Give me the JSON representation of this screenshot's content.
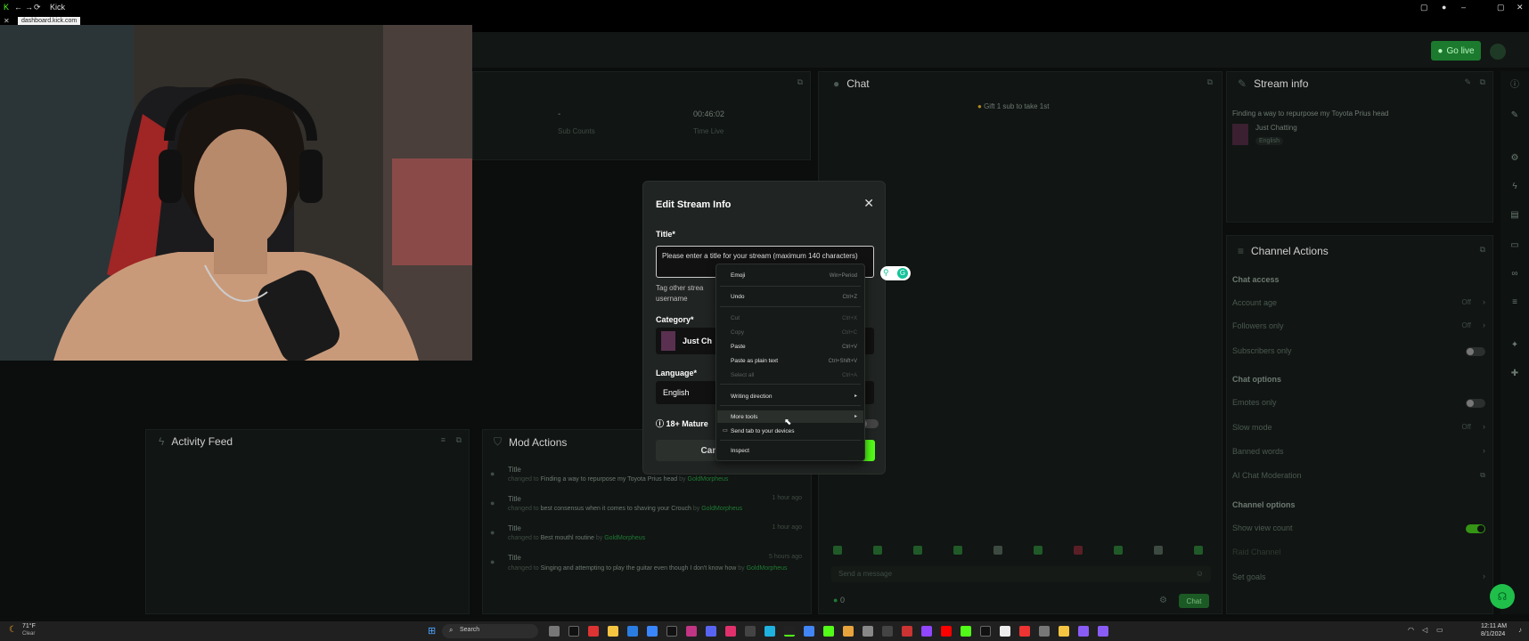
{
  "window": {
    "title": "Kick",
    "url": "dashboard.kick.com"
  },
  "header": {
    "go_live": "Go live"
  },
  "stats": {
    "sub_value": "-",
    "sub_label": "Sub Counts",
    "time_value": "00:46:02",
    "time_label": "Time Live"
  },
  "chat": {
    "title": "Chat",
    "gift_banner": "Gift 1 sub to take 1st",
    "input_placeholder": "Send a message",
    "viewer_count": "0",
    "send_label": "Chat"
  },
  "stream_info": {
    "title": "Stream info",
    "stream_title": "Finding a way to repurpose my Toyota Prius head",
    "category": "Just Chatting",
    "language": "English"
  },
  "channel_actions": {
    "title": "Channel Actions",
    "chat_access": "Chat access",
    "account_age": {
      "label": "Account age",
      "value": "Off"
    },
    "followers_only": {
      "label": "Followers only",
      "value": "Off"
    },
    "subscribers_only": {
      "label": "Subscribers only"
    },
    "chat_options": "Chat options",
    "emotes_only": {
      "label": "Emotes only"
    },
    "slow_mode": {
      "label": "Slow mode",
      "value": "Off"
    },
    "banned_words": "Banned words",
    "ai_moderation": "AI Chat Moderation",
    "channel_options": "Channel options",
    "show_view_count": "Show view count",
    "raid_channel": "Raid Channel",
    "set_goals": "Set goals"
  },
  "activity_feed": {
    "title": "Activity Feed"
  },
  "mod_actions": {
    "title": "Mod Actions",
    "entries": [
      {
        "title": "Title",
        "changed": "changed to",
        "text": "Finding a way to repurpose my Toyota Prius head",
        "by": "by",
        "user": "GoldMorpheus",
        "time": ""
      },
      {
        "title": "Title",
        "changed": "changed to",
        "text": "best consensus when it comes to shaving your Crouch",
        "by": "by",
        "user": "GoldMorpheus",
        "time": "1 hour ago"
      },
      {
        "title": "Title",
        "changed": "changed to",
        "text": "Best mouthl routine",
        "by": "by",
        "user": "GoldMorpheus",
        "time": "1 hour ago"
      },
      {
        "title": "Title",
        "changed": "changed to",
        "text": "Singing and attempting to play the guitar even though I don't know how",
        "by": "by",
        "user": "GoldMorpheus",
        "time": "5 hours ago"
      }
    ]
  },
  "modal": {
    "title": "Edit Stream Info",
    "title_label": "Title*",
    "title_placeholder": "Please enter a title for your stream (maximum 140 characters)",
    "tag_hint_1": "Tag other strea",
    "tag_hint_2": "username",
    "category_label": "Category*",
    "category_value": "Just Ch",
    "language_label": "Language*",
    "language_value": "English",
    "mature_label": "18+ Mature",
    "cancel_label": "Can"
  },
  "context_menu": {
    "emoji": {
      "label": "Emoji",
      "shortcut": "Win+Period"
    },
    "undo": {
      "label": "Undo",
      "shortcut": "Ctrl+Z"
    },
    "cut": {
      "label": "Cut",
      "shortcut": "Ctrl+X"
    },
    "copy": {
      "label": "Copy",
      "shortcut": "Ctrl+C"
    },
    "paste": {
      "label": "Paste",
      "shortcut": "Ctrl+V"
    },
    "paste_plain": {
      "label": "Paste as plain text",
      "shortcut": "Ctrl+Shift+V"
    },
    "select_all": {
      "label": "Select all",
      "shortcut": "Ctrl+A"
    },
    "writing_direction": {
      "label": "Writing direction"
    },
    "more_tools": {
      "label": "More tools"
    },
    "send_tab": {
      "label": "Send tab to your devices"
    },
    "inspect": {
      "label": "Inspect"
    }
  },
  "taskbar": {
    "weather_temp": "71°F",
    "weather_desc": "Clear",
    "search": "Search",
    "time": "12:11 AM",
    "date": "8/1/2024"
  },
  "colors": {
    "accent": "#53fc18",
    "background": "#0b0e0d",
    "panel": "#111513"
  }
}
